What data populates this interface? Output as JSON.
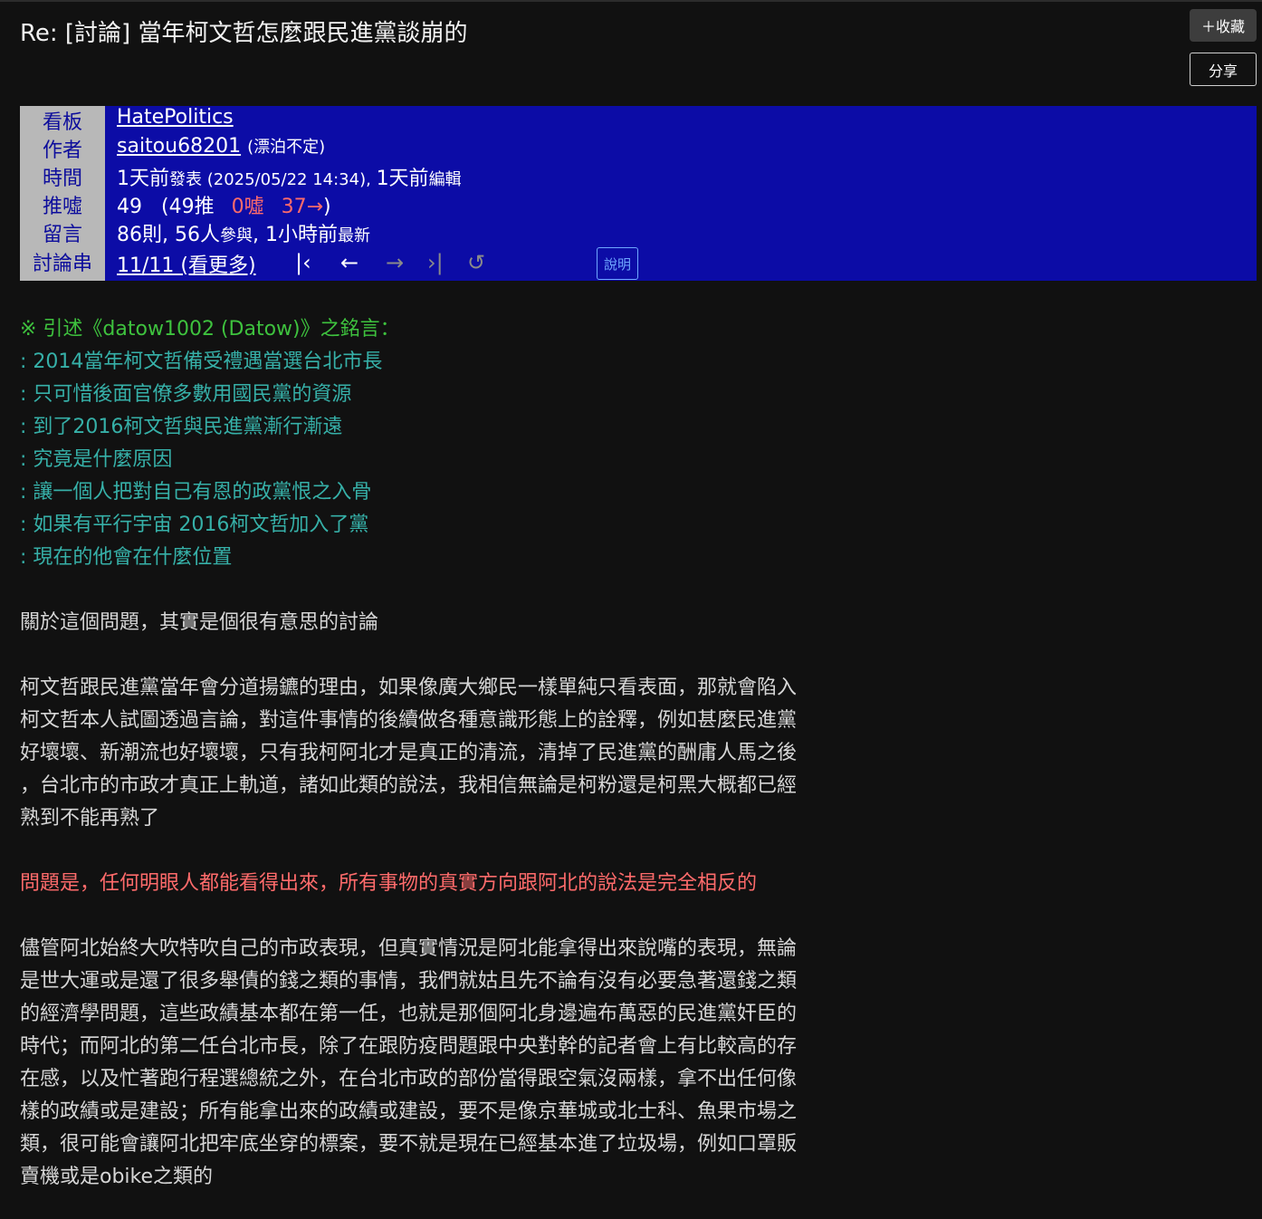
{
  "title": "Re: [討論] 當年柯文哲怎麼跟民進黨談崩的",
  "buttons": {
    "favorite": "＋收藏",
    "share": "分享"
  },
  "meta": {
    "labels": {
      "board": "看板",
      "author": "作者",
      "time": "時間",
      "votes": "推噓",
      "comments": "留言",
      "thread": "討論串"
    },
    "board": "HatePolitics",
    "author_id": "saitou68201",
    "author_nick": "(漂泊不定)",
    "time_posted": "1天前",
    "time_posted_word": "發表",
    "time_detail": " (2025/05/22 14:34), ",
    "time_edited": "1天前",
    "time_edited_word": "編輯",
    "score": "49",
    "push_open": "(49推",
    "boo": "0噓",
    "arrow": "37→",
    "push_close": ")",
    "comment_count": "86則, 56人",
    "comment_participate_word": "參與",
    "comment_latest": ", 1小時前",
    "comment_latest_word": "最新",
    "thread_position": "11/11 (看更多)",
    "help": "說明"
  },
  "nav_icons": [
    "first-icon",
    "prev-icon",
    "next-icon",
    "last-icon",
    "refresh-icon"
  ],
  "quote_header": "※ 引述《datow1002 (Datow)》之銘言：",
  "quote_lines": [
    ": 2014當年柯文哲備受禮遇當選台北市長",
    ": 只可惜後面官僚多數用國民黨的資源",
    ": 到了2016柯文哲與民進黨漸行漸遠",
    ": 究竟是什麼原因",
    ": 讓一個人把對自己有恩的政黨恨之入骨",
    ": 如果有平行宇宙 2016柯文哲加入了黨",
    ": 現在的他會在什麼位置"
  ],
  "para1": "關於這個問題，其實是個很有意思的討論",
  "para2": [
    "柯文哲跟民進黨當年會分道揚鑣的理由，如果像廣大鄉民一樣單純只看表面，那就會陷入",
    "柯文哲本人試圖透過言論，對這件事情的後續做各種意識形態上的詮釋，例如甚麼民進黨",
    "好壞壞、新潮流也好壞壞，只有我柯阿北才是真正的清流，清掉了民進黨的酬庸人馬之後",
    "，台北市的市政才真正上軌道，諸如此類的說法，我相信無論是柯粉還是柯黑大概都已經",
    "熟到不能再熟了"
  ],
  "highlight": "問題是，任何明眼人都能看得出來，所有事物的真實方向跟阿北的說法是完全相反的",
  "para3": [
    "儘管阿北始終大吹特吹自己的市政表現，但真實情況是阿北能拿得出來說嘴的表現，無論",
    "是世大運或是還了很多舉債的錢之類的事情，我們就姑且先不論有沒有必要急著還錢之類",
    "的經濟學問題，這些政績基本都在第一任，也就是那個阿北身邊遍布萬惡的民進黨奸臣的",
    "時代；而阿北的第二任台北市長，除了在跟防疫問題跟中央對幹的記者會上有比較高的存",
    "在感，以及忙著跑行程選總統之外，在台北市政的部份當得跟空氣沒兩樣，拿不出任何像",
    "樣的政績或是建設；所有能拿出來的政績或建設，要不是像京華城或北士科、魚果市場之",
    "類，很可能會讓阿北把牢底坐穿的標案，要不就是現在已經基本進了垃圾場，例如口罩販",
    "賣機或是obike之類的"
  ]
}
